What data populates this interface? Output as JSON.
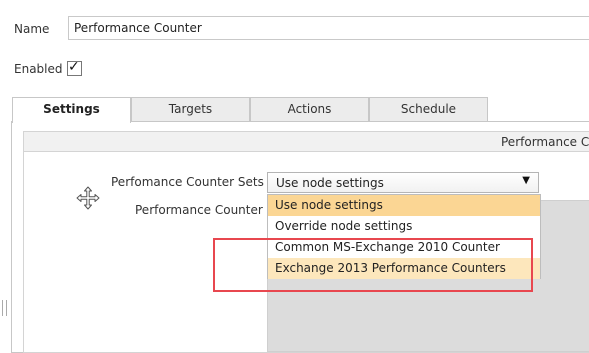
{
  "form": {
    "name_label": "Name",
    "name_value": "Performance Counter",
    "enabled_label": "Enabled",
    "enabled_checked": true,
    "check_glyph": "✓"
  },
  "tabs": [
    {
      "label": "Settings",
      "active": true
    },
    {
      "label": "Targets",
      "active": false
    },
    {
      "label": "Actions",
      "active": false
    },
    {
      "label": "Schedule",
      "active": false
    }
  ],
  "panel": {
    "header_title": "Performance Co",
    "sets_label": "Perfomance Counter Sets",
    "counter_label": "Performance Counter",
    "select_value": "Use node settings",
    "select_arrow": "▼",
    "options": [
      {
        "label": "Use node settings",
        "state": "selected"
      },
      {
        "label": "Override node settings",
        "state": "normal"
      },
      {
        "label": "Common MS-Exchange 2010 Counter",
        "state": "normal"
      },
      {
        "label": "Exchange 2013 Performance Counters",
        "state": "hover"
      }
    ]
  },
  "icons": {
    "move": "move-icon"
  },
  "colors": {
    "selected_option": "#fbd694",
    "hover_option": "#fde7bc",
    "annotation_box": "#e8474f",
    "counter_area": "#dcdcdc"
  }
}
